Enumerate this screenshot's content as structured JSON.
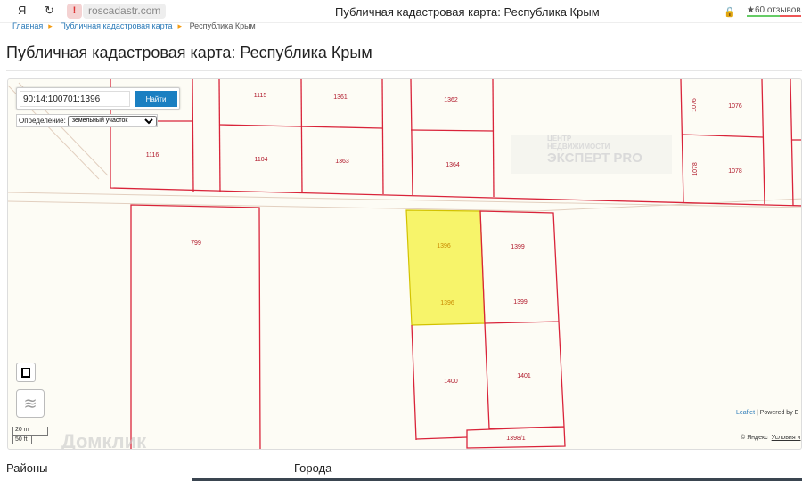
{
  "browser": {
    "url": "roscadastr.com",
    "window_title": "Публичная кадастровая карта: Республика Крым",
    "reviews": "★60 отзывов",
    "yandex_icon": "Я",
    "reload_icon": "↻"
  },
  "breadcrumbs": [
    {
      "label": "Главная"
    },
    {
      "label": "Публичная кадастровая карта"
    },
    {
      "label": "Республика Крым"
    }
  ],
  "page_title": "Публичная кадастровая карта: Республика Крым",
  "map": {
    "search": {
      "value": "90:14:100701:1396",
      "button": "Найти"
    },
    "definition": {
      "label": "Определение:",
      "selected": "земельный участок"
    },
    "parcels": [
      "1115",
      "1361",
      "1362",
      "1076",
      "1076",
      "1116",
      "1104",
      "1363",
      "1364",
      "1078",
      "1078",
      "799",
      "1396",
      "1396",
      "1399",
      "1399",
      "1400",
      "1401",
      "1398/1"
    ],
    "highlight_color": "#f7f46a",
    "boundary_color": "#d9243a",
    "watermark": {
      "line1": "ЦЕНТР",
      "line2": "НЕДВИЖИМОСТИ",
      "line3": "ЭКСПЕРТ PRO"
    },
    "domclick": "Домклик",
    "scale": {
      "metric": "20 m",
      "imperial": "50 ft"
    },
    "attribution": {
      "leaflet": "Leaflet",
      "powered": " | Powered by E",
      "yandex": "© Яндекс",
      "terms": "Условия и"
    }
  },
  "sections": {
    "districts": "Районы",
    "cities": "Города"
  }
}
